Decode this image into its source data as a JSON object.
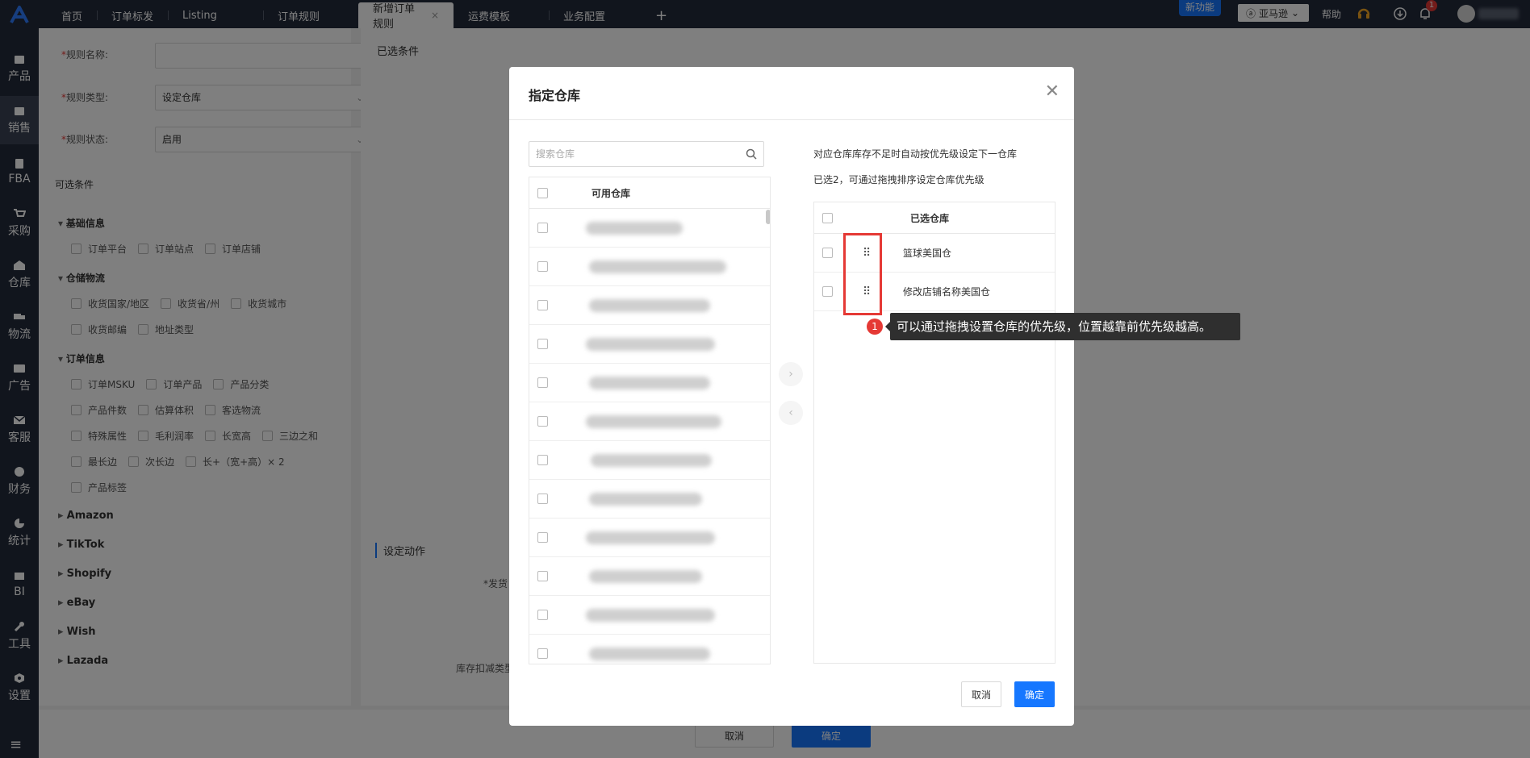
{
  "app": {
    "tabs": [
      {
        "label": "首页"
      },
      {
        "label": "订单标发"
      },
      {
        "label": "Listing"
      },
      {
        "label": "订单规则"
      },
      {
        "label": "新增订单规则",
        "active": true
      },
      {
        "label": "运费模板"
      },
      {
        "label": "业务配置"
      }
    ],
    "add_tab": "+",
    "close_tab": "×",
    "new_feature": "新功能",
    "marketplace": "亚马逊",
    "help": "帮助",
    "notification_count": "1"
  },
  "sidebar": {
    "items": [
      {
        "label": "产品",
        "icon": "product-icon"
      },
      {
        "label": "销售",
        "icon": "sales-icon",
        "active": true
      },
      {
        "label": "FBA",
        "icon": "fba-icon"
      },
      {
        "label": "采购",
        "icon": "cart-icon"
      },
      {
        "label": "仓库",
        "icon": "warehouse-icon"
      },
      {
        "label": "物流",
        "icon": "truck-icon"
      },
      {
        "label": "广告",
        "icon": "ad-icon"
      },
      {
        "label": "客服",
        "icon": "mail-icon"
      },
      {
        "label": "财务",
        "icon": "finance-icon"
      },
      {
        "label": "统计",
        "icon": "pie-icon"
      },
      {
        "label": "BI",
        "icon": "bi-icon"
      },
      {
        "label": "工具",
        "icon": "wrench-icon"
      },
      {
        "label": "设置",
        "icon": "settings-icon"
      }
    ],
    "menu_icon": "≡"
  },
  "form": {
    "rule_name_label": "规则名称:",
    "rule_type_label": "规则类型:",
    "rule_type_value": "设定仓库",
    "rule_status_label": "规则状态:",
    "rule_status_value": "启用",
    "optional_conditions": "可选条件",
    "groups": {
      "basic": "基础信息",
      "basic_items": [
        "订单平台",
        "订单站点",
        "订单店铺"
      ],
      "logistics": "仓储物流",
      "logistics_row1": [
        "收货国家/地区",
        "收货省/州",
        "收货城市"
      ],
      "logistics_row2": [
        "收货邮编",
        "地址类型"
      ],
      "order": "订单信息",
      "order_row1": [
        "订单MSKU",
        "订单产品",
        "产品分类"
      ],
      "order_row2": [
        "产品件数",
        "估算体积",
        "客选物流"
      ],
      "order_row3": [
        "特殊属性",
        "毛利润率",
        "长宽高",
        "三边之和"
      ],
      "order_row4": [
        "最长边",
        "次长边",
        "长+（宽+高）× 2"
      ],
      "order_row5": [
        "产品标签"
      ]
    },
    "platforms": [
      "Amazon",
      "TikTok",
      "Shopify",
      "eBay",
      "Wish",
      "Lazada"
    ],
    "selected_conditions": "已选条件",
    "set_action": "设定动作",
    "ship_label": "*发货",
    "inventory_label": "库存扣减类型",
    "cancel": "取消",
    "confirm": "确定"
  },
  "modal": {
    "title": "指定仓库",
    "search_placeholder": "搜索仓库",
    "available_header": "可用仓库",
    "hint1": "对应仓库库存不足时自动按优先级设定下一仓库",
    "hint2": "已选2，可通过拖拽排序设定仓库优先级",
    "selected_header": "已选仓库",
    "selected_items": [
      "篮球美国仓",
      "修改店铺名称美国仓"
    ],
    "tooltip_number": "1",
    "tooltip": "可以通过拖拽设置仓库的优先级，位置越靠前优先级越高。",
    "cancel": "取消",
    "confirm": "确定",
    "move_right": "›",
    "move_left": "‹"
  }
}
